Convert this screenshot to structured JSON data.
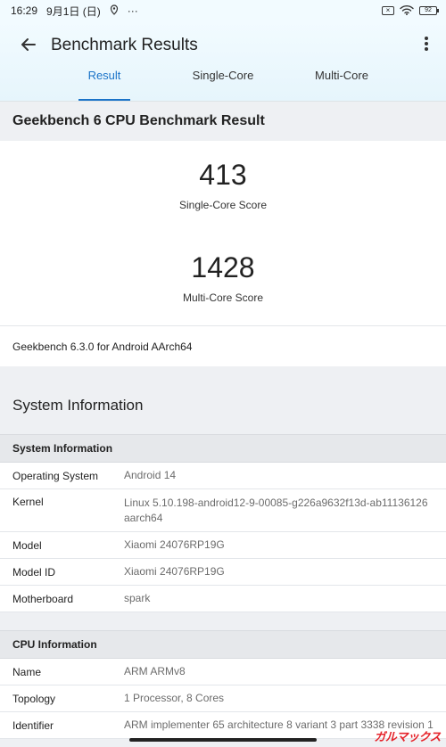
{
  "status": {
    "time": "16:29",
    "date": "9月1日 (日)",
    "dots": "···",
    "battery": "92"
  },
  "header": {
    "title": "Benchmark Results"
  },
  "tabs": [
    {
      "label": "Result"
    },
    {
      "label": "Single-Core"
    },
    {
      "label": "Multi-Core"
    }
  ],
  "result": {
    "heading": "Geekbench 6 CPU Benchmark Result",
    "single_score": "413",
    "single_label": "Single-Core Score",
    "multi_score": "1428",
    "multi_label": "Multi-Core Score",
    "version": "Geekbench 6.3.0 for Android AArch64"
  },
  "system": {
    "title": "System Information",
    "table_header": "System Information",
    "rows": [
      {
        "key": "Operating System",
        "value": "Android 14"
      },
      {
        "key": "Kernel",
        "value": "Linux 5.10.198-android12-9-00085-g226a9632f13d-ab11136126",
        "value2": "aarch64"
      },
      {
        "key": "Model",
        "value": "Xiaomi 24076RP19G"
      },
      {
        "key": "Model ID",
        "value": "Xiaomi 24076RP19G"
      },
      {
        "key": "Motherboard",
        "value": "spark"
      }
    ]
  },
  "cpu": {
    "table_header": "CPU Information",
    "rows": [
      {
        "key": "Name",
        "value": "ARM ARMv8"
      },
      {
        "key": "Topology",
        "value": "1 Processor, 8 Cores"
      },
      {
        "key": "Identifier",
        "value": "ARM implementer 65 architecture 8 variant 3 part 3338 revision 1"
      }
    ]
  },
  "watermark": "ガルマックス",
  "colors": {
    "accent": "#1a73c8",
    "watermark": "#e5242b"
  }
}
